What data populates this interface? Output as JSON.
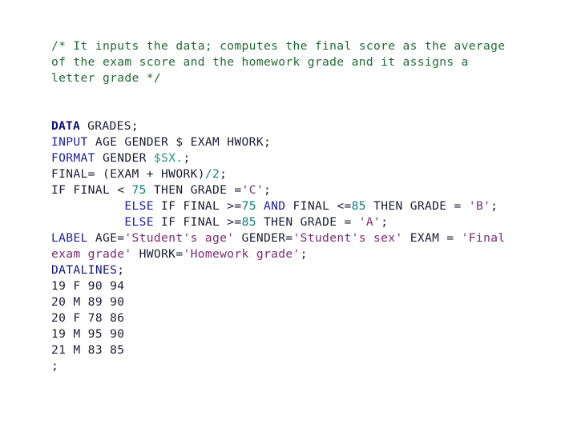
{
  "document": {
    "type": "sas-code-listing",
    "background_color": "#ffffff",
    "default_text_color": "#1c1c30",
    "palette": {
      "comment": "#1f6b34",
      "keyword": "#20219c",
      "keyword_bold": "#10107a",
      "plain": "#1c1c30",
      "number": "#0f7d7d",
      "format": "#2a8f86",
      "string": "#7a2a6e",
      "navy": "#141470"
    }
  },
  "code": {
    "lines": [
      {
        "id": "comment-1",
        "indent": 0,
        "tokens": [
          {
            "text": "/* It inputs the data; computes the final score as the average",
            "kind": "comment"
          }
        ]
      },
      {
        "id": "comment-2",
        "indent": 0,
        "tokens": [
          {
            "text": "of the exam score and the homework grade and it assigns a",
            "kind": "comment"
          }
        ]
      },
      {
        "id": "comment-3",
        "indent": 0,
        "tokens": [
          {
            "text": "letter grade */",
            "kind": "comment"
          }
        ]
      },
      {
        "id": "blank-1",
        "indent": 0,
        "tokens": []
      },
      {
        "id": "blank-2",
        "indent": 0,
        "tokens": []
      },
      {
        "id": "data-statement",
        "indent": 0,
        "tokens": [
          {
            "text": "DATA",
            "kind": "keyword_bold"
          },
          {
            "text": " GRADES;",
            "kind": "plain"
          }
        ]
      },
      {
        "id": "input-statement",
        "indent": 0,
        "tokens": [
          {
            "text": "INPUT",
            "kind": "keyword"
          },
          {
            "text": " AGE GENDER $ EXAM HWORK;",
            "kind": "plain"
          }
        ]
      },
      {
        "id": "format-statement",
        "indent": 0,
        "tokens": [
          {
            "text": "FORMAT",
            "kind": "keyword"
          },
          {
            "text": " GENDER ",
            "kind": "plain"
          },
          {
            "text": "$SX.",
            "kind": "format"
          },
          {
            "text": ";",
            "kind": "plain"
          }
        ]
      },
      {
        "id": "final-assignment",
        "indent": 0,
        "tokens": [
          {
            "text": "FINAL= (EXAM + HWORK)",
            "kind": "plain"
          },
          {
            "text": "/",
            "kind": "number"
          },
          {
            "text": "2",
            "kind": "number"
          },
          {
            "text": ";",
            "kind": "plain"
          }
        ]
      },
      {
        "id": "if-grade-c",
        "indent": 0,
        "tokens": [
          {
            "text": "IF FINAL < ",
            "kind": "plain"
          },
          {
            "text": "75",
            "kind": "number"
          },
          {
            "text": " THEN GRADE =",
            "kind": "plain"
          },
          {
            "text": "'C'",
            "kind": "string"
          },
          {
            "text": ";",
            "kind": "plain"
          }
        ]
      },
      {
        "id": "else-if-grade-b",
        "indent": 10,
        "tokens": [
          {
            "text": "ELSE",
            "kind": "keyword"
          },
          {
            "text": " IF FINAL >=",
            "kind": "plain"
          },
          {
            "text": "75",
            "kind": "number"
          },
          {
            "text": " ",
            "kind": "plain"
          },
          {
            "text": "AND",
            "kind": "keyword"
          },
          {
            "text": " FINAL <=",
            "kind": "plain"
          },
          {
            "text": "85",
            "kind": "number"
          },
          {
            "text": " THEN GRADE = ",
            "kind": "plain"
          },
          {
            "text": "'B'",
            "kind": "string"
          },
          {
            "text": ";",
            "kind": "plain"
          }
        ]
      },
      {
        "id": "else-if-grade-a",
        "indent": 10,
        "tokens": [
          {
            "text": "ELSE",
            "kind": "keyword"
          },
          {
            "text": " IF FINAL >=",
            "kind": "plain"
          },
          {
            "text": "85",
            "kind": "number"
          },
          {
            "text": " THEN GRADE = ",
            "kind": "plain"
          },
          {
            "text": "'A'",
            "kind": "string"
          },
          {
            "text": ";",
            "kind": "plain"
          }
        ]
      },
      {
        "id": "label-statement-1",
        "indent": 0,
        "tokens": [
          {
            "text": "LABEL",
            "kind": "keyword"
          },
          {
            "text": " AGE=",
            "kind": "plain"
          },
          {
            "text": "'Student's age'",
            "kind": "string"
          },
          {
            "text": " GENDER=",
            "kind": "plain"
          },
          {
            "text": "'Student's sex'",
            "kind": "string"
          },
          {
            "text": " EXAM = ",
            "kind": "plain"
          },
          {
            "text": "'Final",
            "kind": "string"
          }
        ]
      },
      {
        "id": "label-statement-2",
        "indent": 0,
        "tokens": [
          {
            "text": "exam grade'",
            "kind": "string"
          },
          {
            "text": " HWORK=",
            "kind": "plain"
          },
          {
            "text": "'Homework grade'",
            "kind": "string"
          },
          {
            "text": ";",
            "kind": "plain"
          }
        ]
      },
      {
        "id": "datalines-statement",
        "indent": 0,
        "tokens": [
          {
            "text": "DATALINES;",
            "kind": "navy"
          }
        ]
      },
      {
        "id": "data-row-1",
        "indent": 0,
        "tokens": [
          {
            "text": "19 F 90 94",
            "kind": "plain"
          }
        ]
      },
      {
        "id": "data-row-2",
        "indent": 0,
        "tokens": [
          {
            "text": "20 M 89 90",
            "kind": "plain"
          }
        ]
      },
      {
        "id": "data-row-3",
        "indent": 0,
        "tokens": [
          {
            "text": "20 F 78 86",
            "kind": "plain"
          }
        ]
      },
      {
        "id": "data-row-4",
        "indent": 0,
        "tokens": [
          {
            "text": "19 M 95 90",
            "kind": "plain"
          }
        ]
      },
      {
        "id": "data-row-5",
        "indent": 0,
        "tokens": [
          {
            "text": "21 M 83 85",
            "kind": "plain"
          }
        ]
      },
      {
        "id": "terminator",
        "indent": 0,
        "tokens": [
          {
            "text": ";",
            "kind": "plain"
          }
        ]
      }
    ]
  }
}
